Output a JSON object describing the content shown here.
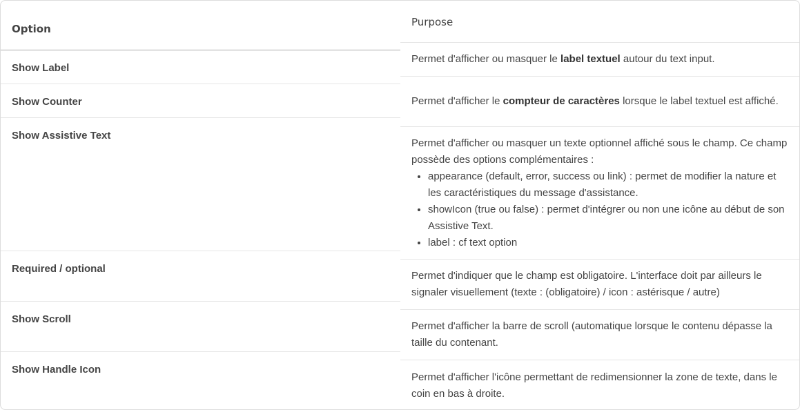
{
  "table": {
    "header": {
      "option": "Option",
      "purpose": "Purpose"
    },
    "rows": [
      {
        "option": "Show Label",
        "purpose_before": "Permet d'afficher ou masquer le ",
        "purpose_bold": "label textuel",
        "purpose_after": " autour du text input."
      },
      {
        "option": "Show Counter",
        "purpose_before": "Permet d'afficher le ",
        "purpose_bold": "compteur de caractères",
        "purpose_after": " lorsque le label textuel est affiché."
      },
      {
        "option": "Show Assistive Text",
        "purpose_intro": "Permet d'afficher ou masquer un texte optionnel affiché sous le champ. Ce champ possède des options complémentaires :",
        "purpose_items": [
          "appearance (default, error, success ou link) : permet de modifier la nature et les caractéristiques du message d'assistance.",
          "showIcon (true ou false) : permet d'intégrer ou non une icône au début de son Assistive Text.",
          "label : cf text option"
        ]
      },
      {
        "option": "Required / optional",
        "purpose": "Permet d'indiquer que le champ est obligatoire. L'interface doit par ailleurs le signaler visuellement (texte : (obligatoire) / icon : astérisque / autre)"
      },
      {
        "option": "Show Scroll",
        "purpose": "Permet d'afficher la barre de scroll (automatique lorsque le contenu dépasse la taille du contenant."
      },
      {
        "option": "Show Handle Icon",
        "purpose": "Permet d'afficher l'icône permettant de redimensionner la zone de texte, dans le coin en bas à droite."
      }
    ]
  }
}
